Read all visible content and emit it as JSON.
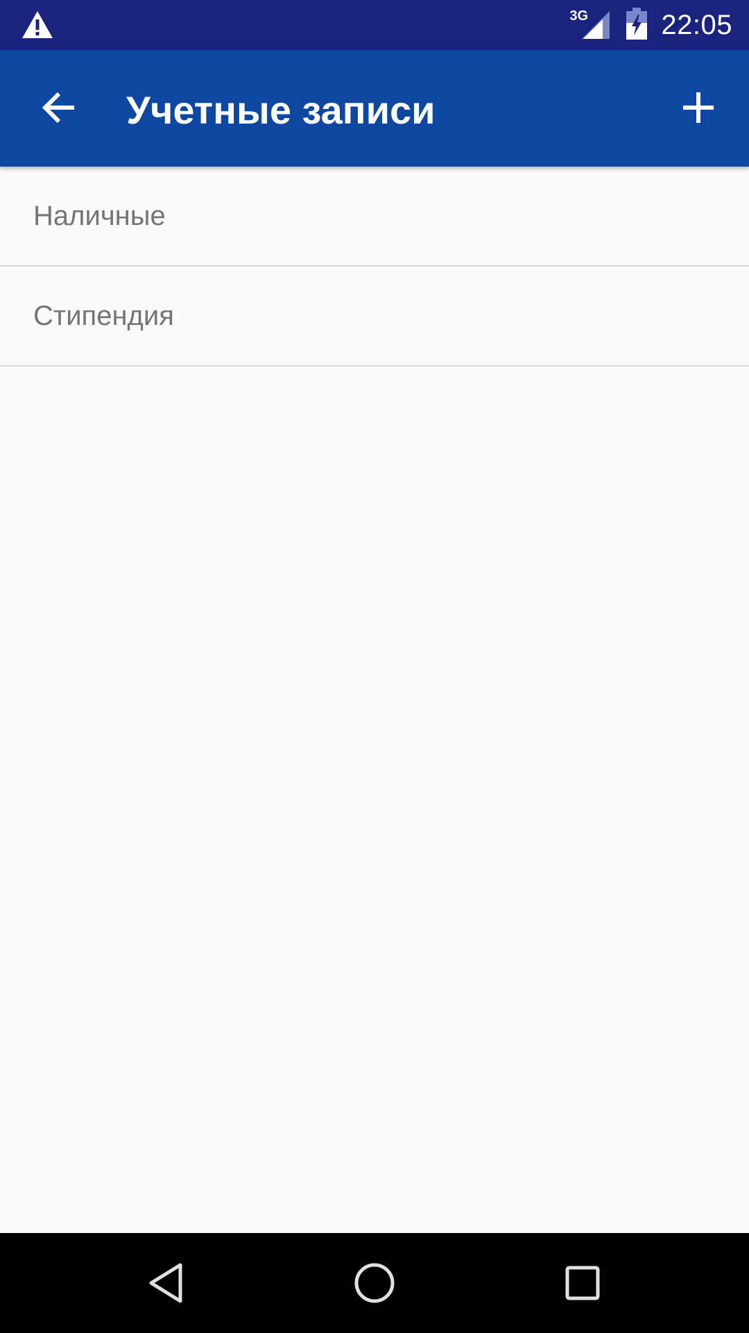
{
  "status_bar": {
    "network_type": "3G",
    "time": "22:05",
    "icons": [
      "warning-icon",
      "signal-icon",
      "battery-charging-icon"
    ]
  },
  "app_bar": {
    "title": "Учетные записи",
    "back_icon": "arrow-back-icon",
    "add_icon": "plus-icon",
    "color": "#0d47a1"
  },
  "accounts": {
    "items": [
      {
        "label": "Наличные"
      },
      {
        "label": "Стипендия"
      }
    ]
  },
  "nav_bar": {
    "icons": [
      "nav-back-icon",
      "nav-home-icon",
      "nav-recent-icon"
    ]
  },
  "colors": {
    "status_bar": "#1a237e",
    "app_bar": "#0d47a1",
    "background": "#fafafa",
    "item_text": "#757575"
  }
}
